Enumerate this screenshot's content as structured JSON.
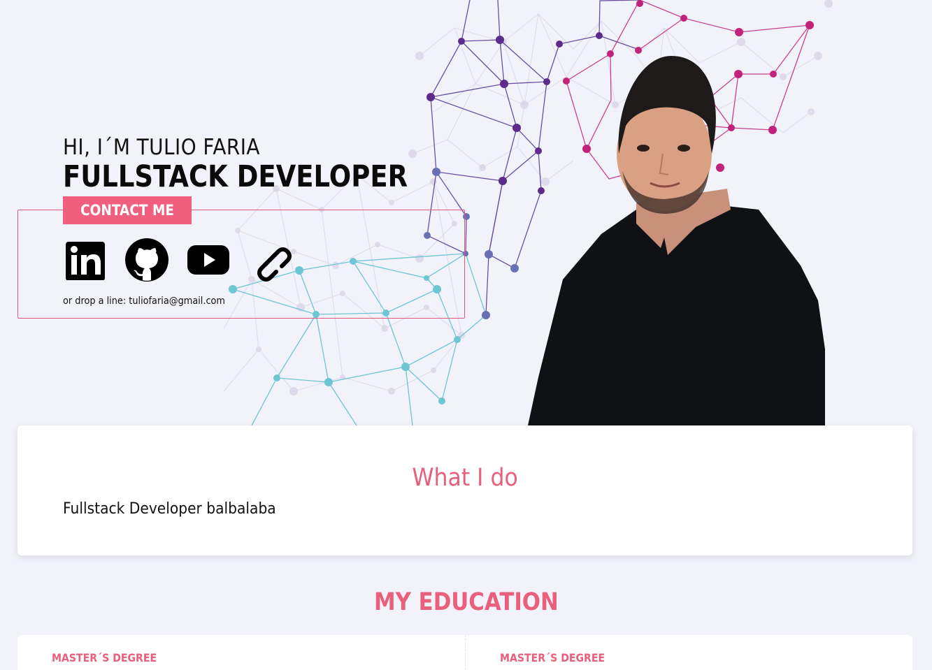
{
  "hero": {
    "greeting": "HI, I´M TULIO FARIA",
    "role": "FULLSTACK DEVELOPER",
    "contact_button": "CONTACT ME",
    "drop_line": "or drop a line: tuliofaria@gmail.com",
    "social": [
      {
        "name": "linkedin-icon"
      },
      {
        "name": "github-icon"
      },
      {
        "name": "youtube-icon"
      },
      {
        "name": "link-icon"
      }
    ]
  },
  "what_i_do": {
    "title": "What I do",
    "text": "Fullstack Developer balbalaba"
  },
  "education": {
    "title": "MY EDUCATION",
    "items": [
      {
        "degree": "MASTER´S DEGREE"
      },
      {
        "degree": "MASTER´S DEGREE"
      }
    ]
  },
  "colors": {
    "accent": "#f0607e",
    "background": "#f2f2fb",
    "network_cyan": "#6cc6d3",
    "network_purple": "#5d2b8a",
    "network_magenta": "#c2237a"
  }
}
